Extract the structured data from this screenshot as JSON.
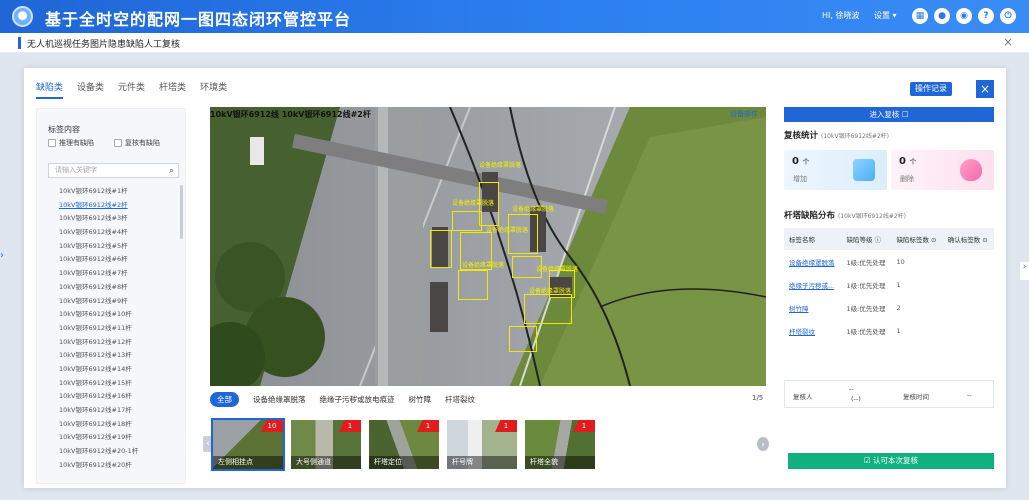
{
  "header": {
    "app_title": "基于全时空的配网一图四态闭环管控平台",
    "user_greeting": "HI, 徐晓波",
    "nav_menu": "设置 ▾",
    "icons": [
      "grid-icon",
      "circle-icon",
      "settings-icon",
      "help-icon",
      "power-icon"
    ]
  },
  "subbar": {
    "title": "无人机巡视任务图片隐患缺陷人工复核",
    "close": "×"
  },
  "modal": {
    "tabs": [
      "缺陷类",
      "设备类",
      "元件类",
      "杆塔类",
      "环境类"
    ],
    "active_tab": 0,
    "op_log_label": "操作记录",
    "close_label": "×"
  },
  "left_panel": {
    "title": "标签内容",
    "checkbox_1": "推理有缺陷",
    "checkbox_2": "复核有缺陷",
    "search_placeholder": "请输入关键字",
    "towers": [
      "10kV银环6912线#1杆",
      "10kV银环6912线#2杆",
      "10kV银环6912线#3杆",
      "10kV银环6912线#4杆",
      "10kV银环6912线#5杆",
      "10kV银环6912线#6杆",
      "10kV银环6912线#7杆",
      "10kV银环6912线#8杆",
      "10kV银环6912线#9杆",
      "10kV银环6912线#10杆",
      "10kV银环6912线#11杆",
      "10kV银环6912线#12杆",
      "10kV银环6912线#13杆",
      "10kV银环6912线#14杆",
      "10kV银环6912线#15杆",
      "10kV银环6912线#16杆",
      "10kV银环6912线#17杆",
      "10kV银环6912线#18杆",
      "10kV银环6912线#19杆",
      "10kV银环6912线#20-1杆",
      "10kV银环6912线#20杆"
    ],
    "active_tower": 1
  },
  "photo": {
    "title": "10kV银环6912线 10kV银环6912线#2杆",
    "tag": "设备部件",
    "detection_labels": [
      "设备绝缘罩脱落",
      "设备绝缘罩脱落",
      "设备绝缘罩脱落",
      "设备绝缘罩脱落",
      "设备绝缘罩脱落",
      "设备绝缘罩脱落",
      "设备绝缘罩脱落"
    ]
  },
  "filter_chips": [
    "全部",
    "设备绝缘罩脱落",
    "绝缘子污秽或放电痕迹",
    "树竹障",
    "杆塔裂纹"
  ],
  "active_chip": 0,
  "page_indicator": "1/5",
  "thumbnails": [
    {
      "caption": "左侧相挂点",
      "badge": "10"
    },
    {
      "caption": "大号侧通道",
      "badge": "1"
    },
    {
      "caption": "杆塔定位",
      "badge": "1"
    },
    {
      "caption": "杆号牌",
      "badge": "1"
    },
    {
      "caption": "杆塔全貌",
      "badge": "1"
    }
  ],
  "right_panel": {
    "enter_review_label": "进入复核 ☐",
    "review_stats_title": "复核统计",
    "review_stats_sub": "(10kV银环6912线#2杆)",
    "added_count": "0",
    "added_unit": "个",
    "added_label": "增加",
    "deleted_count": "0",
    "deleted_unit": "个",
    "deleted_label": "删除",
    "dist_title": "杆塔缺陷分布",
    "dist_sub": "(10kV银环6912线#2杆)",
    "table_headers": [
      "标签名称",
      "缺陷等级 ⓘ",
      "缺陷标签数 ⊙",
      "确认标签数 ⊙"
    ],
    "table_rows": [
      [
        "设备绝缘罩脱落",
        "1级:优先处理",
        "10",
        ""
      ],
      [
        "绝缘子污秽或...",
        "1级:优先处理",
        "1",
        ""
      ],
      [
        "树竹障",
        "1级:优先处理",
        "2",
        ""
      ],
      [
        "杆塔裂纹",
        "1级:优先处理",
        "1",
        ""
      ]
    ],
    "reviewer_label": "复核人",
    "reviewer_value_1": "--",
    "reviewer_value_2": "(--)",
    "review_time_label": "复核时间",
    "review_time_value": "--",
    "confirm_label": "☑ 认可本次复核"
  }
}
